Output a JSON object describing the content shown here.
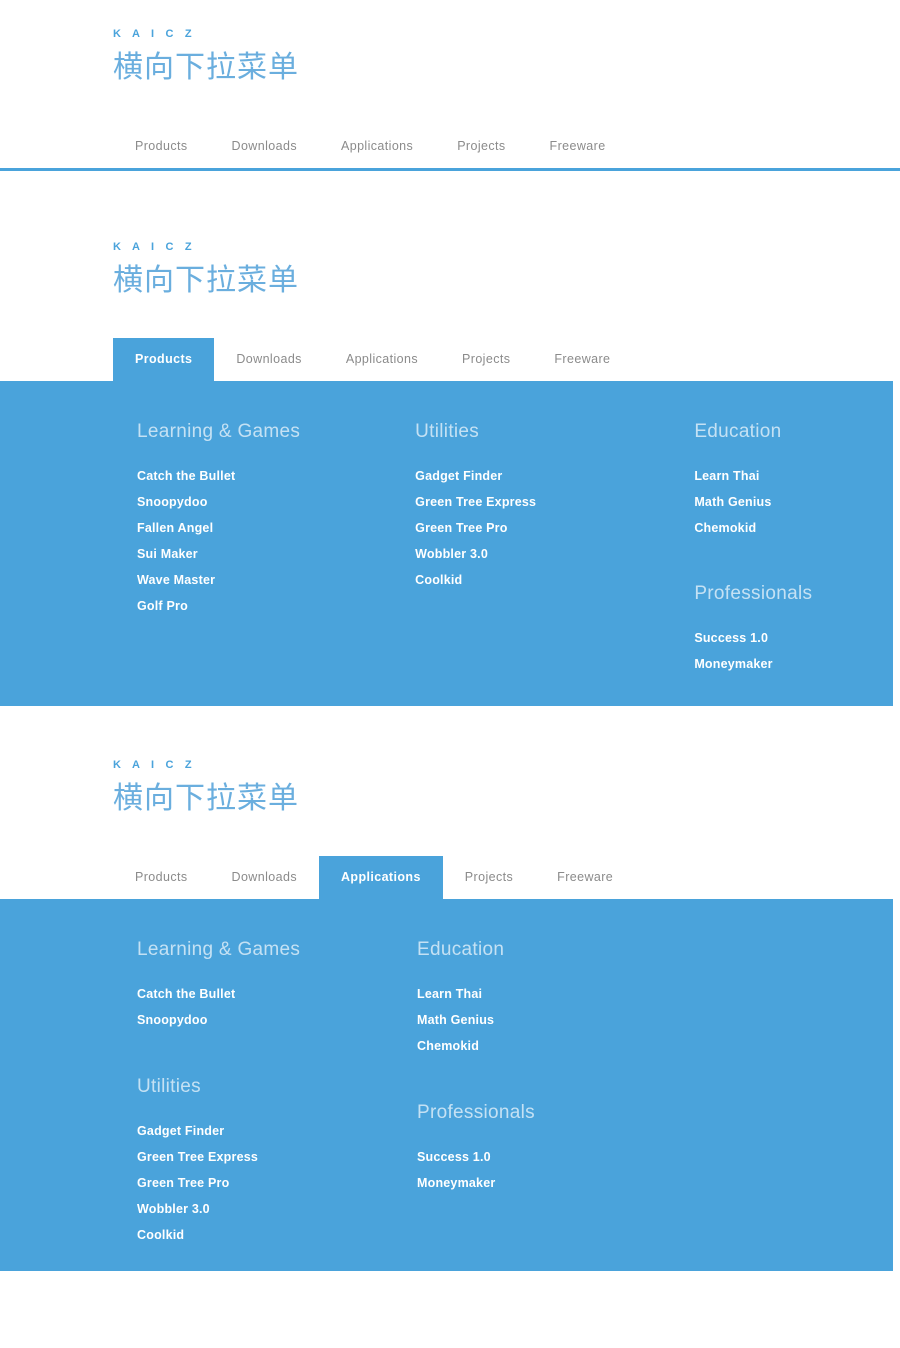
{
  "brand": "K A I C Z",
  "headline": "横向下拉菜单",
  "colors": {
    "accent": "#4aa3db",
    "headline": "#6aaede",
    "nav_text": "#8b8b8b",
    "panel_bg": "#4aa3db",
    "group_title": "rgba(255,255,255,0.68)",
    "item_text": "#ffffff"
  },
  "nav": [
    {
      "label": "Products"
    },
    {
      "label": "Downloads"
    },
    {
      "label": "Applications"
    },
    {
      "label": "Projects"
    },
    {
      "label": "Freeware"
    }
  ],
  "sections": [
    {
      "id": "closed",
      "active_tab": null,
      "panel_open": false
    },
    {
      "id": "products-open",
      "active_tab": "Products",
      "panel_open": true,
      "layout": "three-column",
      "columns": [
        {
          "groups": [
            {
              "title": "Learning & Games",
              "items": [
                "Catch the Bullet",
                "Snoopydoo",
                "Fallen Angel",
                "Sui Maker",
                "Wave Master",
                "Golf Pro"
              ]
            }
          ]
        },
        {
          "groups": [
            {
              "title": "Utilities",
              "items": [
                "Gadget Finder",
                "Green Tree Express",
                "Green Tree Pro",
                "Wobbler 3.0",
                "Coolkid"
              ]
            }
          ]
        },
        {
          "groups": [
            {
              "title": "Education",
              "items": [
                "Learn Thai",
                "Math Genius",
                "Chemokid"
              ]
            },
            {
              "title": "Professionals",
              "items": [
                "Success 1.0",
                "Moneymaker"
              ]
            }
          ]
        }
      ]
    },
    {
      "id": "applications-open",
      "active_tab": "Applications",
      "panel_open": true,
      "layout": "two-column",
      "columns": [
        {
          "groups": [
            {
              "title": "Learning & Games",
              "items": [
                "Catch the Bullet",
                "Snoopydoo"
              ]
            },
            {
              "title": "Utilities",
              "items": [
                "Gadget Finder",
                "Green Tree Express",
                "Green Tree Pro",
                "Wobbler 3.0",
                "Coolkid"
              ]
            }
          ]
        },
        {
          "groups": [
            {
              "title": "Education",
              "items": [
                "Learn Thai",
                "Math Genius",
                "Chemokid"
              ]
            },
            {
              "title": "Professionals",
              "items": [
                "Success 1.0",
                "Moneymaker"
              ]
            }
          ]
        }
      ]
    }
  ]
}
